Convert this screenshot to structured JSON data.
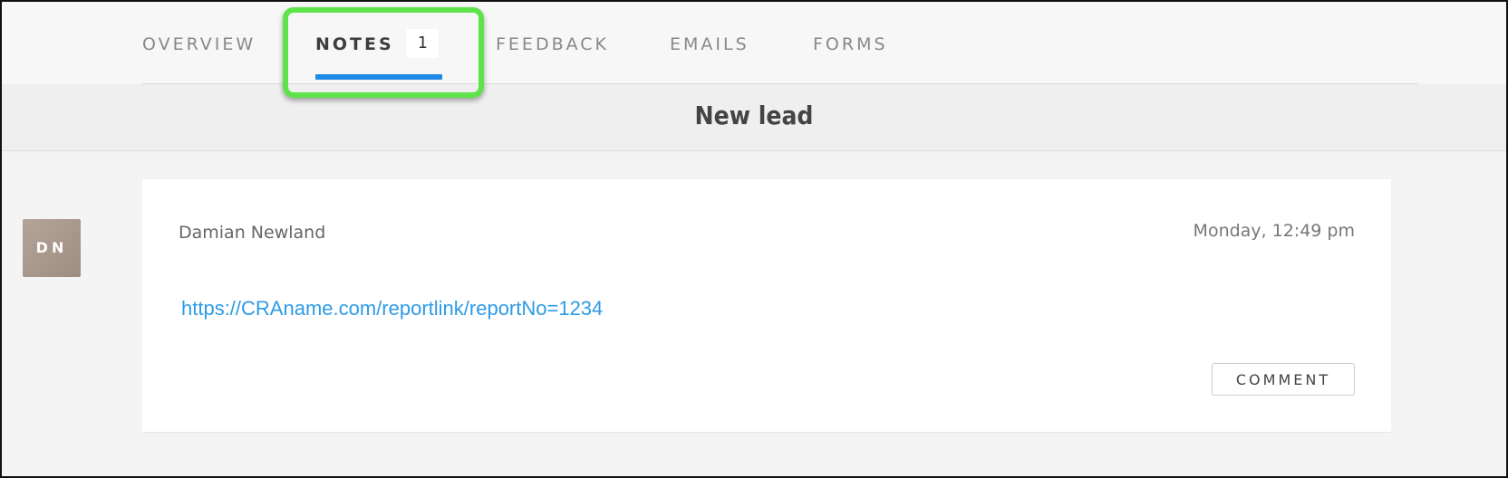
{
  "tabs": [
    {
      "label": "OVERVIEW"
    },
    {
      "label": "NOTES",
      "badge": "1"
    },
    {
      "label": "FEEDBACK"
    },
    {
      "label": "EMAILS"
    },
    {
      "label": "FORMS"
    }
  ],
  "section": {
    "title": "New lead"
  },
  "note": {
    "author_initials": "DN",
    "author_name": "Damian Newland",
    "timestamp": "Monday, 12:49 pm",
    "link_text": "https://CRAname.com/reportlink/reportNo=1234",
    "comment_label": "COMMENT"
  },
  "colors": {
    "accent": "#1e8ae6",
    "link": "#2e9be6",
    "highlight": "#5ee34a"
  }
}
